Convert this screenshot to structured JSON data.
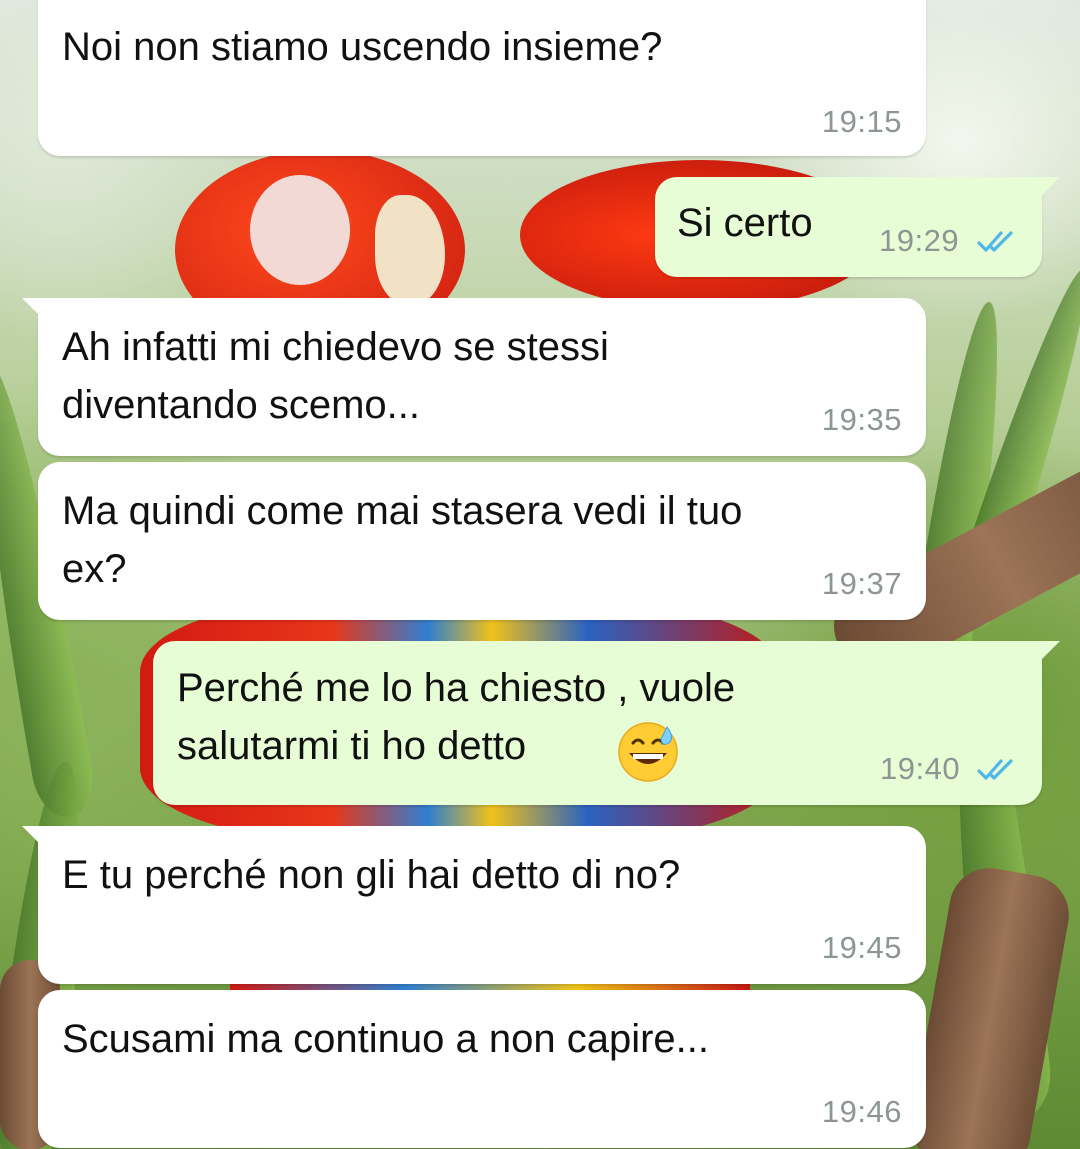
{
  "chat": {
    "messages": [
      {
        "direction": "incoming",
        "text": "Noi non stiamo uscendo insieme?",
        "time": "19:15"
      },
      {
        "direction": "outgoing",
        "text": "Si certo",
        "time": "19:29",
        "status": "read",
        "status_icon": "double-check-icon"
      },
      {
        "direction": "incoming",
        "text": "Ah infatti mi chiedevo se stessi\ndiventando scemo...",
        "time": "19:35"
      },
      {
        "direction": "incoming",
        "text": "Ma quindi come mai stasera vedi il tuo\nex?",
        "time": "19:37"
      },
      {
        "direction": "outgoing",
        "text": "Perché me lo ha chiesto , vuole\nsalutarmi ti ho detto",
        "emoji": "grinning-face-with-sweat-icon",
        "time": "19:40",
        "status": "read",
        "status_icon": "double-check-icon"
      },
      {
        "direction": "incoming",
        "text": "E tu perché non gli hai detto di no?",
        "time": "19:45"
      },
      {
        "direction": "incoming",
        "text": "Scusami ma continuo a non capire...",
        "time": "19:46"
      }
    ]
  },
  "colors": {
    "incoming_bubble": "#ffffff",
    "outgoing_bubble": "#e7fdd6",
    "timestamp": "#8d9692",
    "read_ticks": "#4fb6ec",
    "text": "#111111"
  },
  "wallpaper": {
    "subject": "scarlet macaws on branch with green foliage"
  }
}
